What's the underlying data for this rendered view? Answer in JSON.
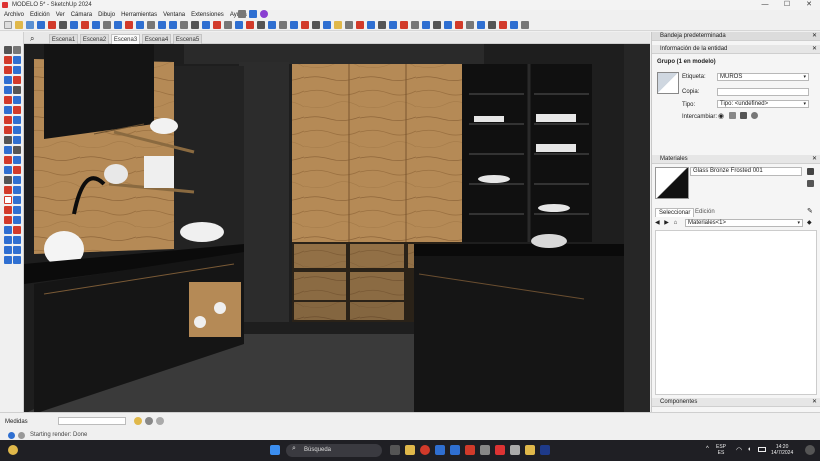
{
  "window": {
    "title": "MODELO 5* - SketchUp 2024",
    "minimize": "—",
    "maximize": "☐",
    "close": "✕"
  },
  "menu": [
    "Archivo",
    "Edición",
    "Ver",
    "Cámara",
    "Dibujo",
    "Herramientas",
    "Ventana",
    "Extensiones",
    "Ayuda"
  ],
  "scenes": {
    "search_icon": "search-icon",
    "tabs": [
      "Escena1",
      "Escena2",
      "Escena3",
      "Escena4",
      "Escena5"
    ],
    "active_index": 2
  },
  "tray": {
    "title": "Bandeja predeterminada",
    "entity_info": {
      "header": "Información de la entidad",
      "group_label": "Grupo (1 en modelo)",
      "tag_label": "Etiqueta:",
      "tag_value": "MUROS",
      "instance_label": "Copia:",
      "instance_value": "",
      "type_label": "Tipo:",
      "type_value": "Tipo: <undefined>",
      "toggles_label": "Intercambiar:"
    },
    "materials": {
      "header": "Materiales",
      "current_name": "Glass Bronze Frosted 001",
      "tab_select": "Seleccionar",
      "tab_edit": "Edición",
      "library": "Materiales<1>"
    },
    "components": {
      "header": "Componentes"
    }
  },
  "status": {
    "measurements_label": "Medidas",
    "message": "Starting render: Done"
  },
  "taskbar": {
    "search_placeholder": "Búsqueda",
    "lang": "ESP",
    "lang_sub": "ES",
    "time": "14:20",
    "date": "14/7/2024"
  },
  "colors": {
    "toolbar_blue": "#2f6fd1",
    "toolbar_red": "#d23a2a",
    "wood": "#b58a56",
    "cabinet_dark": "#141414",
    "taskbar": "#1f1f24"
  }
}
